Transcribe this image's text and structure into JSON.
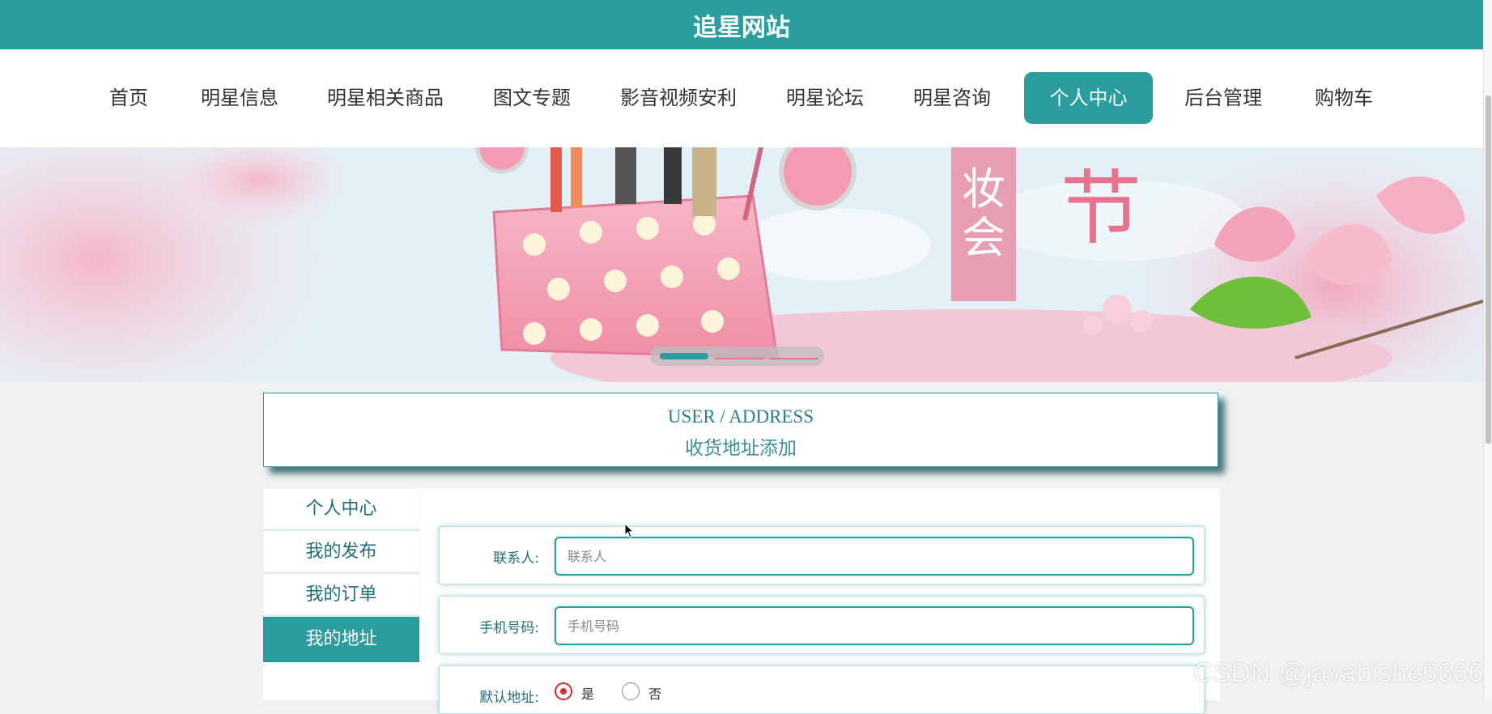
{
  "site": {
    "title": "追星网站"
  },
  "nav": {
    "items": [
      {
        "label": "首页"
      },
      {
        "label": "明星信息"
      },
      {
        "label": "明星相关商品"
      },
      {
        "label": "图文专题"
      },
      {
        "label": "影音视频安利"
      },
      {
        "label": "明星论坛"
      },
      {
        "label": "明星咨询"
      },
      {
        "label": "个人中心",
        "active": true
      },
      {
        "label": "后台管理"
      },
      {
        "label": "购物车"
      }
    ]
  },
  "banner": {
    "image_text": [
      "妆会",
      "节"
    ],
    "slides": 3,
    "active_slide": 1
  },
  "section": {
    "title_en": "USER / ADDRESS",
    "title_cn": "收货地址添加"
  },
  "sidebar": {
    "items": [
      {
        "label": "个人中心"
      },
      {
        "label": "我的发布"
      },
      {
        "label": "我的订单"
      },
      {
        "label": "我的地址",
        "active": true
      }
    ]
  },
  "form": {
    "contact": {
      "label": "联系人:",
      "placeholder": "联系人",
      "value": ""
    },
    "phone": {
      "label": "手机号码:",
      "placeholder": "手机号码",
      "value": ""
    },
    "default_address": {
      "label": "默认地址:",
      "options": [
        {
          "label": "是",
          "checked": true
        },
        {
          "label": "否",
          "checked": false
        }
      ]
    }
  },
  "watermark": {
    "text": "CSDN @javabishe6666"
  },
  "colors": {
    "accent": "#2a9d9f",
    "radio": "#d32f2f",
    "background": "#f1f1f1"
  }
}
